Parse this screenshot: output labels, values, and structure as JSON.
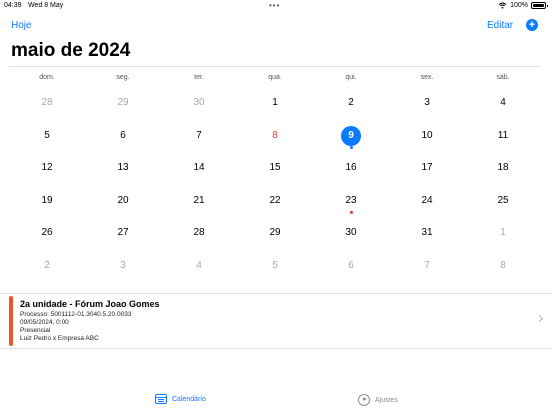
{
  "status_bar": {
    "time": "04:39",
    "date": "Wed 8 May",
    "battery": "100%"
  },
  "nav": {
    "today_label": "Hoje",
    "edit_label": "Editar",
    "add_label": "+"
  },
  "month_title": "maio de 2024",
  "weekdays": [
    "dom.",
    "seg.",
    "ter.",
    "qua.",
    "qui.",
    "sex.",
    "sáb."
  ],
  "weeks": [
    [
      {
        "n": "28",
        "other": true
      },
      {
        "n": "29",
        "other": true
      },
      {
        "n": "30",
        "other": true
      },
      {
        "n": "1"
      },
      {
        "n": "2"
      },
      {
        "n": "3"
      },
      {
        "n": "4"
      }
    ],
    [
      {
        "n": "5"
      },
      {
        "n": "6"
      },
      {
        "n": "7"
      },
      {
        "n": "8",
        "holiday": true
      },
      {
        "n": "9",
        "selected": true,
        "dot": "#0a7bff"
      },
      {
        "n": "10"
      },
      {
        "n": "11"
      }
    ],
    [
      {
        "n": "12"
      },
      {
        "n": "13"
      },
      {
        "n": "14"
      },
      {
        "n": "15"
      },
      {
        "n": "16"
      },
      {
        "n": "17"
      },
      {
        "n": "18"
      }
    ],
    [
      {
        "n": "19"
      },
      {
        "n": "20"
      },
      {
        "n": "21"
      },
      {
        "n": "22"
      },
      {
        "n": "23",
        "dot": "#e63b30"
      },
      {
        "n": "24"
      },
      {
        "n": "25"
      }
    ],
    [
      {
        "n": "26"
      },
      {
        "n": "27"
      },
      {
        "n": "28"
      },
      {
        "n": "29"
      },
      {
        "n": "30"
      },
      {
        "n": "31"
      },
      {
        "n": "1",
        "other": true
      }
    ],
    [
      {
        "n": "2",
        "other": true
      },
      {
        "n": "3",
        "other": true
      },
      {
        "n": "4",
        "other": true
      },
      {
        "n": "5",
        "other": true
      },
      {
        "n": "6",
        "other": true
      },
      {
        "n": "7",
        "other": true
      },
      {
        "n": "8",
        "other": true
      }
    ]
  ],
  "event": {
    "title": "2a unidade - Fórum Joao Gomes",
    "process": "Processo: 5001112-01.3040.5.20.0033",
    "datetime": "09/05/2024, 0:00",
    "mode": "Presencial",
    "parties": "Luiz Pedro x Empresa ABC",
    "color": "#f0542d"
  },
  "tabs": {
    "calendar_label": "Calendário",
    "settings_label": "Ajustes"
  },
  "colors": {
    "accent": "#0a7bff",
    "holiday": "#e63b30"
  }
}
